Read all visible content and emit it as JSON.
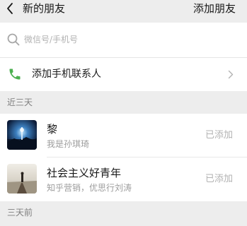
{
  "nav": {
    "title": "新的朋友",
    "action_label": "添加朋友"
  },
  "search": {
    "placeholder": "微信号/手机号",
    "value": ""
  },
  "phone_contacts": {
    "label": "添加手机联系人",
    "icon": "phone-icon"
  },
  "sections": [
    {
      "header": "近三天",
      "friends": [
        {
          "name": "黎",
          "description": "我是孙琪琦",
          "status": "已添加"
        },
        {
          "name": "社会主义好青年",
          "description": "知乎营销，优思行刘涛",
          "status": "已添加"
        }
      ]
    },
    {
      "header": "三天前",
      "friends": []
    }
  ],
  "colors": {
    "phone_green": "#4caf50",
    "background": "#ededed",
    "secondary_text": "#9d9d9d"
  }
}
